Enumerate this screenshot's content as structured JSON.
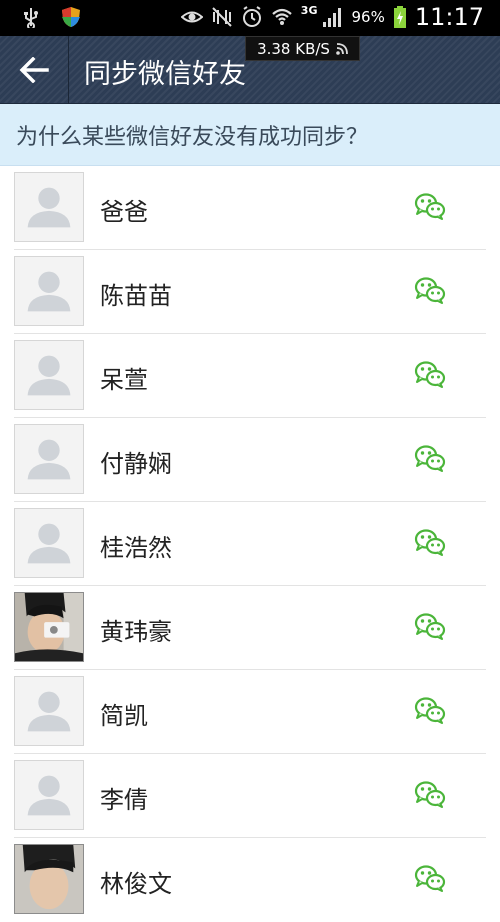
{
  "status_bar": {
    "battery_percent": "96%",
    "time": "11:17",
    "network_type": "3G",
    "speed": "3.38 KB/S",
    "icons": [
      "usb-icon",
      "shield-app-icon",
      "eye-icon",
      "nfc-mute-icon",
      "alarm-icon",
      "wifi-icon",
      "signal-icon",
      "battery-charging-icon",
      "rss-icon"
    ]
  },
  "action_bar": {
    "back_icon": "back-arrow-icon",
    "title": "同步微信好友"
  },
  "banner": {
    "text": "为什么某些微信好友没有成功同步？"
  },
  "colors": {
    "action_bar_bg": "#2d3d55",
    "banner_bg": "#daeefa",
    "wechat_green": "#4bb53a"
  },
  "friends": [
    {
      "name": "爸爸",
      "avatar": "default-avatar-icon",
      "source_icon": "wechat-icon"
    },
    {
      "name": "陈苗苗",
      "avatar": "default-avatar-icon",
      "source_icon": "wechat-icon"
    },
    {
      "name": "呆萱",
      "avatar": "default-avatar-icon",
      "source_icon": "wechat-icon"
    },
    {
      "name": "付静娴",
      "avatar": "default-avatar-icon",
      "source_icon": "wechat-icon"
    },
    {
      "name": "桂浩然",
      "avatar": "default-avatar-icon",
      "source_icon": "wechat-icon"
    },
    {
      "name": "黄玮豪",
      "avatar": "photo-avatar",
      "source_icon": "wechat-icon"
    },
    {
      "name": "简凯",
      "avatar": "default-avatar-icon",
      "source_icon": "wechat-icon"
    },
    {
      "name": "李倩",
      "avatar": "default-avatar-icon",
      "source_icon": "wechat-icon"
    },
    {
      "name": "林俊文",
      "avatar": "photo-avatar",
      "source_icon": "wechat-icon"
    }
  ]
}
